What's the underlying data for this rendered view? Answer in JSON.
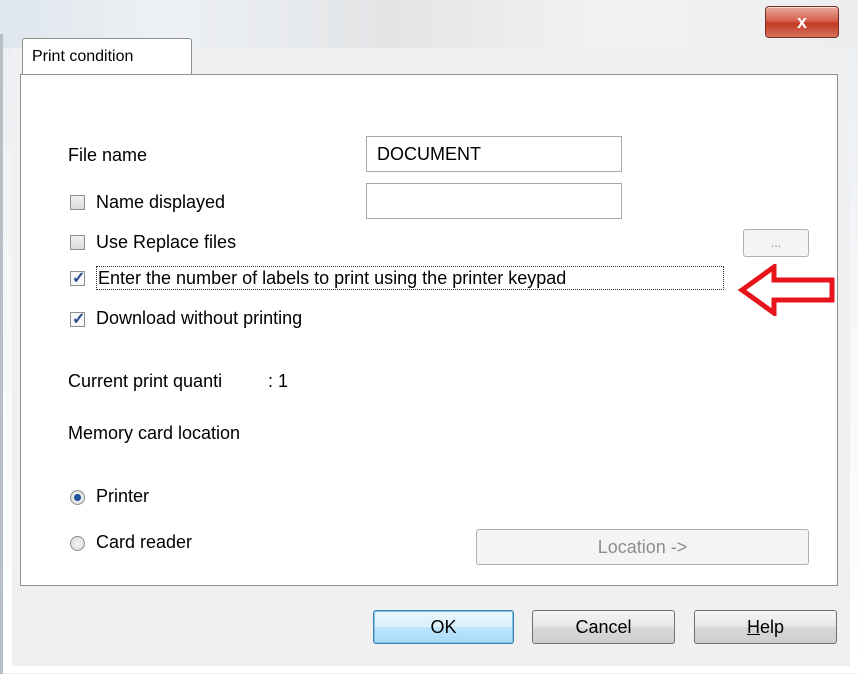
{
  "window": {
    "close_label": "x"
  },
  "tab": {
    "label": "Print condition"
  },
  "file_name": {
    "label": "File name",
    "value": "DOCUMENT"
  },
  "name_displayed": {
    "label": "Name displayed",
    "checked": false,
    "value": ""
  },
  "use_replace_files": {
    "label": "Use Replace files",
    "checked": false,
    "browse_label": "..."
  },
  "keypad_option": {
    "label": "Enter the number of labels to print using the printer keypad",
    "checked": true
  },
  "download_option": {
    "label": "Download without printing",
    "checked": true
  },
  "current_print": {
    "label": "Current print quanti",
    "value": ": 1"
  },
  "memory_card": {
    "label": "Memory card location",
    "options": [
      {
        "label": "Printer",
        "selected": true
      },
      {
        "label": "Card reader",
        "selected": false
      }
    ],
    "location_button": "Location ->"
  },
  "buttons": {
    "ok": "OK",
    "cancel": "Cancel",
    "help_h": "H",
    "help_rest": "elp"
  },
  "colors": {
    "annotation_arrow": "#e8141c",
    "checkbox_tick": "#2a4d8f"
  },
  "icons": {
    "annotation": "red-left-arrow-icon"
  }
}
